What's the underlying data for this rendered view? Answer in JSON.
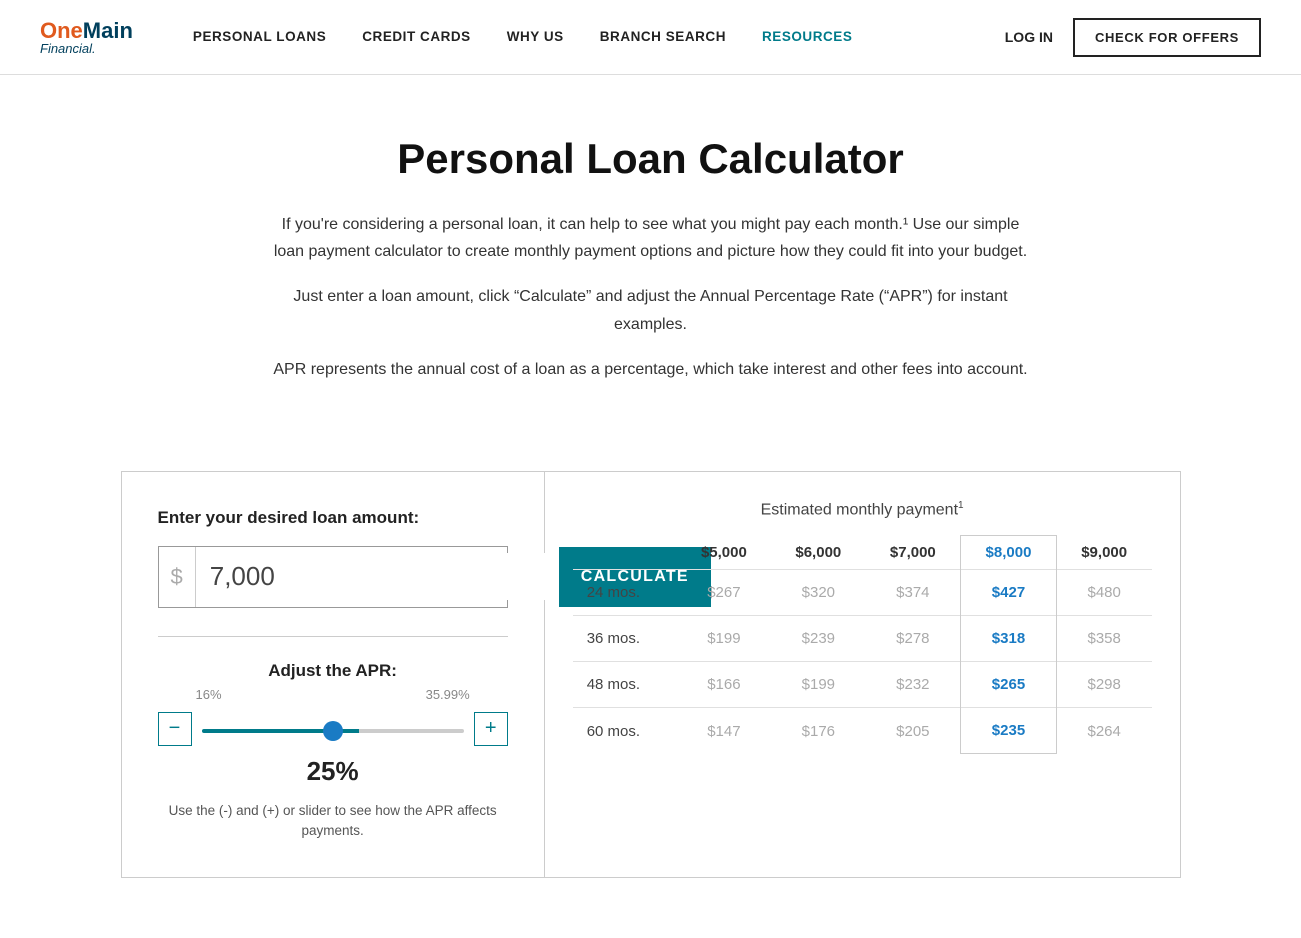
{
  "nav": {
    "logo_one": "OneMain",
    "logo_one_highlight": "One",
    "logo_financial": "Financial.",
    "links": [
      {
        "label": "PERSONAL LOANS",
        "active": false
      },
      {
        "label": "CREDIT CARDS",
        "active": false
      },
      {
        "label": "WHY US",
        "active": false
      },
      {
        "label": "BRANCH SEARCH",
        "active": false
      },
      {
        "label": "RESOURCES",
        "active": true
      }
    ],
    "login": "LOG IN",
    "cta": "CHECK FOR OFFERS"
  },
  "hero": {
    "title": "Personal Loan Calculator",
    "p1": "If you're considering a personal loan, it can help to see what you might pay each month.¹ Use our simple loan payment calculator to create monthly payment options and picture how they could fit into your budget.",
    "p2": "Just enter a loan amount, click “Calculate” and adjust the Annual Percentage Rate (“APR”) for instant examples.",
    "p3": "APR represents the annual cost of a loan as a percentage, which take interest and other fees into account."
  },
  "calculator": {
    "left": {
      "label": "Enter your desired loan amount:",
      "dollar_sign": "$",
      "loan_value": "7,000",
      "loan_placeholder": "7,000",
      "calc_button": "CALCULATE",
      "apr_label": "Adjust the APR:",
      "apr_min": "16%",
      "apr_max": "35.99%",
      "apr_value": "25%",
      "apr_slider_value": 50,
      "minus_btn": "−",
      "plus_btn": "+",
      "hint": "Use the (-) and (+) or slider to see how the APR affects payments."
    },
    "right": {
      "title": "Estimated monthly payment",
      "title_sup": "1",
      "columns": [
        "",
        "$5,000",
        "$6,000",
        "$7,000",
        "$8,000",
        "$9,000"
      ],
      "highlighted_col": 4,
      "rows": [
        {
          "label": "24 mos.",
          "values": [
            "$267",
            "$320",
            "$374",
            "$427",
            "$480"
          ]
        },
        {
          "label": "36 mos.",
          "values": [
            "$199",
            "$239",
            "$278",
            "$318",
            "$358"
          ]
        },
        {
          "label": "48 mos.",
          "values": [
            "$166",
            "$199",
            "$232",
            "$265",
            "$298"
          ]
        },
        {
          "label": "60 mos.",
          "values": [
            "$147",
            "$176",
            "$205",
            "$235",
            "$264"
          ]
        }
      ]
    }
  }
}
